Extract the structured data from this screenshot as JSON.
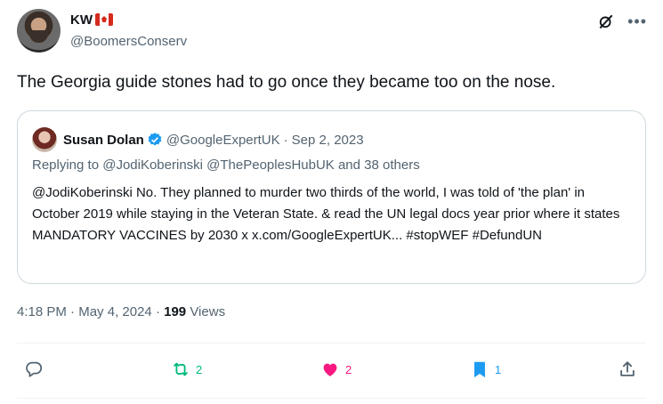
{
  "author": {
    "name": "KW",
    "flag": "canada-flag",
    "handle": "@BoomersConserv"
  },
  "tweet": {
    "text": "The Georgia guide stones had to go once they became too on the nose."
  },
  "quote": {
    "name": "Susan Dolan",
    "handle": "@GoogleExpertUK",
    "separator": "·",
    "date": "Sep 2, 2023",
    "replying": "Replying to @JodiKoberinski @ThePeoplesHubUK and 38 others",
    "body": "@JodiKoberinski No. They planned to murder two thirds of the world, I was told of 'the plan' in October 2019 while staying in the Veteran State. & read the UN legal docs year prior where it states MANDATORY VACCINES by 2030 x x.com/GoogleExpertUK... #stopWEF #DefundUN"
  },
  "meta": {
    "time": "4:18 PM",
    "sep1": "·",
    "date": "May 4, 2024",
    "sep2": "·",
    "views_count": "199",
    "views_label": "Views"
  },
  "actions": {
    "reply": {
      "icon": "reply-icon",
      "count": ""
    },
    "repost": {
      "icon": "repost-icon",
      "count": "2",
      "color": "#00ba7c"
    },
    "like": {
      "icon": "heart-icon",
      "count": "2",
      "color": "#f91880"
    },
    "bookmark": {
      "icon": "bookmark-icon",
      "count": "1",
      "color": "#1d9bf0"
    },
    "share": {
      "icon": "share-icon"
    }
  },
  "colors": {
    "text": "#0f1419",
    "secondary": "#536471",
    "border": "#cfd9de",
    "verified": "#1d9bf0"
  }
}
